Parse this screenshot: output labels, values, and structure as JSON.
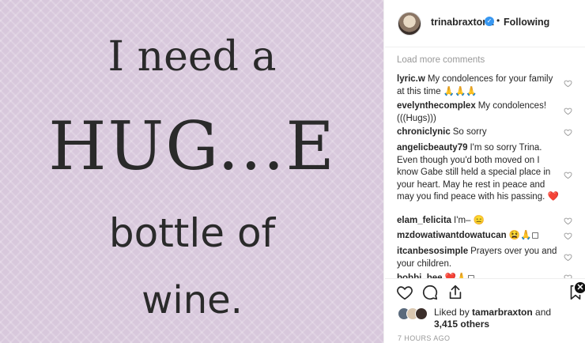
{
  "image": {
    "line1": "I need a",
    "line2": "HUG...E",
    "line3": "bottle of",
    "line4": "wine.",
    "background_color": "#d8c8dc"
  },
  "header": {
    "username": "trinabraxton1",
    "verified_icon": "verified-badge-icon",
    "separator": "•",
    "follow_status": "Following"
  },
  "comments": {
    "load_more": "Load more comments",
    "items": [
      {
        "user": "lyric.w",
        "text": "My condolences for your family at this time 🙏🙏🙏"
      },
      {
        "user": "evelynthecomplex",
        "text": "My condolences! (((Hugs)))"
      },
      {
        "user": "chroniclynic",
        "text": "So sorry"
      },
      {
        "user": "angelicbeauty79",
        "text": "I'm so sorry Trina. Even though you'd both moved on I know Gabe still held a special place in your heart. May he rest in peace and may you find peace with his passing. ❤️"
      },
      {
        "user": "elam_felicita",
        "text": "I'm– 😑"
      },
      {
        "user": "mzdowatiwantdowatucan",
        "text": "😫🙏◻"
      },
      {
        "user": "itcanbesosimple",
        "text": "Prayers over you and your children."
      },
      {
        "user": "bobbi_bee",
        "text": "❤️🙏◻"
      }
    ]
  },
  "actions": {
    "like_icon": "heart-icon",
    "comment_icon": "comment-icon",
    "share_icon": "share-icon",
    "save_icon": "bookmark-icon",
    "liked_by_prefix": "Liked by ",
    "liked_by_user": "tamarbraxton",
    "liked_by_and": " and ",
    "others": "3,415 others",
    "timestamp": "7 HOURS AGO"
  },
  "overlay": {
    "close_icon": "close-icon",
    "close_glyph": "✕"
  }
}
